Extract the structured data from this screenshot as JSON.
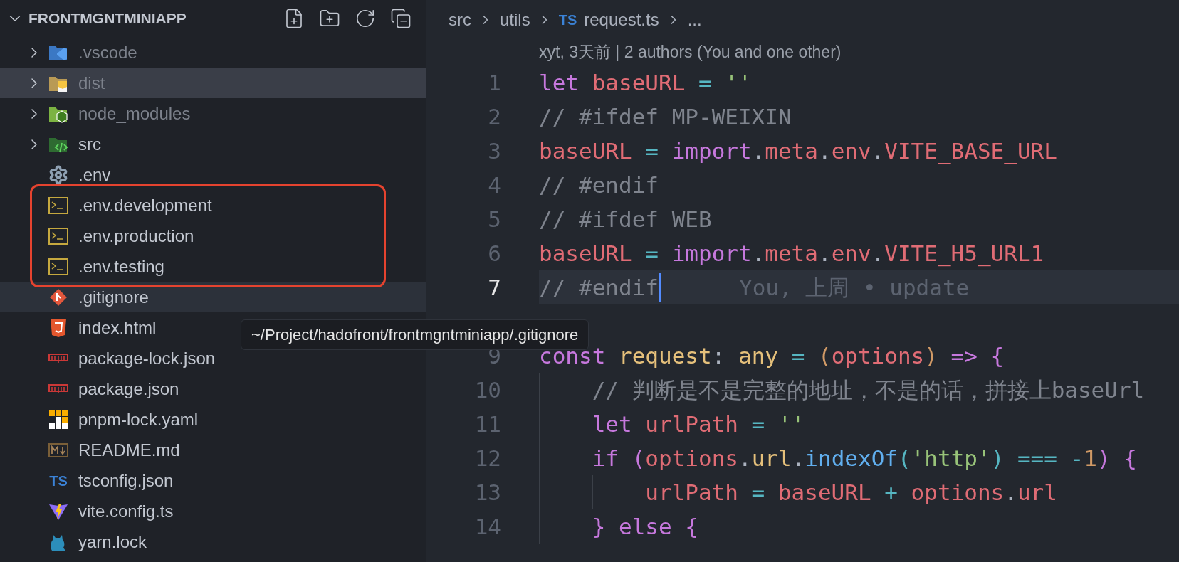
{
  "explorer": {
    "title": "FRONTMGNTMINIAPP",
    "expanded": true,
    "items": [
      {
        "name": ".vscode",
        "kind": "vscode",
        "expanded": false,
        "dimmed": true,
        "selected": false,
        "hovered": false
      },
      {
        "name": "dist",
        "kind": "dist",
        "expanded": false,
        "dimmed": true,
        "selected": true,
        "hovered": false
      },
      {
        "name": "node_modules",
        "kind": "node",
        "expanded": false,
        "dimmed": true,
        "selected": false,
        "hovered": false
      },
      {
        "name": "src",
        "kind": "src",
        "expanded": false,
        "dimmed": false,
        "selected": false,
        "hovered": false
      },
      {
        "name": ".env",
        "kind": "gear",
        "dimmed": false,
        "selected": false,
        "hovered": false
      },
      {
        "kind": "highlight",
        "items": [
          {
            "name": ".env.development",
            "kind": "terminal",
            "dimmed": false,
            "selected": false,
            "hovered": false
          },
          {
            "name": ".env.production",
            "kind": "terminal",
            "dimmed": false,
            "selected": false,
            "hovered": false
          },
          {
            "name": ".env.testing",
            "kind": "terminal",
            "dimmed": false,
            "selected": false,
            "hovered": false
          }
        ]
      },
      {
        "name": ".gitignore",
        "kind": "git",
        "dimmed": false,
        "selected": false,
        "hovered": true
      },
      {
        "name": "index.html",
        "kind": "html",
        "dimmed": false,
        "selected": false,
        "hovered": false
      },
      {
        "name": "package-lock.json",
        "kind": "npm",
        "dimmed": false,
        "selected": false,
        "hovered": false
      },
      {
        "name": "package.json",
        "kind": "npm",
        "dimmed": false,
        "selected": false,
        "hovered": false
      },
      {
        "name": "pnpm-lock.yaml",
        "kind": "pnpm",
        "dimmed": false,
        "selected": false,
        "hovered": false
      },
      {
        "name": "README.md",
        "kind": "markdown",
        "dimmed": false,
        "selected": false,
        "hovered": false
      },
      {
        "name": "tsconfig.json",
        "kind": "ts",
        "badge": "TS",
        "dimmed": false,
        "selected": false,
        "hovered": false
      },
      {
        "name": "vite.config.ts",
        "kind": "vite",
        "dimmed": false,
        "selected": false,
        "hovered": false
      },
      {
        "name": "yarn.lock",
        "kind": "yarn",
        "dimmed": false,
        "selected": false,
        "hovered": false
      }
    ]
  },
  "tooltip": "~/Project/hadofront/frontmgntminiapp/.gitignore",
  "breadcrumb": [
    {
      "label": "src"
    },
    {
      "label": "utils"
    },
    {
      "label": "request.ts",
      "badge": "TS"
    },
    {
      "label": "..."
    }
  ],
  "editor": {
    "blame_header": "xyt, 3天前 | 2 authors (You and one other)",
    "lines": [
      {
        "number": "1",
        "current": false,
        "tokens": [
          {
            "kind": "keyword",
            "text": "let "
          },
          {
            "kind": "variable",
            "text": "baseURL "
          },
          {
            "kind": "operator",
            "text": "= "
          },
          {
            "kind": "string",
            "text": "''"
          }
        ]
      },
      {
        "number": "2",
        "current": false,
        "tokens": [
          {
            "kind": "comment",
            "text": "// #ifdef MP-WEIXIN"
          }
        ]
      },
      {
        "number": "3",
        "current": false,
        "tokens": [
          {
            "kind": "variable",
            "text": "baseURL "
          },
          {
            "kind": "operator",
            "text": "= "
          },
          {
            "kind": "keyword",
            "text": "import"
          },
          {
            "kind": "punct",
            "text": "."
          },
          {
            "kind": "variable",
            "text": "meta"
          },
          {
            "kind": "punct",
            "text": "."
          },
          {
            "kind": "variable",
            "text": "env"
          },
          {
            "kind": "punct",
            "text": "."
          },
          {
            "kind": "variable",
            "text": "VITE_BASE_URL"
          }
        ]
      },
      {
        "number": "4",
        "current": false,
        "tokens": [
          {
            "kind": "comment",
            "text": "// #endif"
          }
        ]
      },
      {
        "number": "5",
        "current": false,
        "tokens": [
          {
            "kind": "comment",
            "text": "// #ifdef WEB"
          }
        ]
      },
      {
        "number": "6",
        "current": false,
        "tokens": [
          {
            "kind": "variable",
            "text": "baseURL "
          },
          {
            "kind": "operator",
            "text": "= "
          },
          {
            "kind": "keyword",
            "text": "import"
          },
          {
            "kind": "punct",
            "text": "."
          },
          {
            "kind": "variable",
            "text": "meta"
          },
          {
            "kind": "punct",
            "text": "."
          },
          {
            "kind": "variable",
            "text": "env"
          },
          {
            "kind": "punct",
            "text": "."
          },
          {
            "kind": "variable",
            "text": "VITE_H5_URL1"
          }
        ]
      },
      {
        "number": "7",
        "current": true,
        "blame": "You, 上周 • update",
        "tokens": [
          {
            "kind": "comment",
            "text": "// #endif"
          }
        ]
      },
      {
        "current": false
      },
      {
        "number": "9",
        "current": false,
        "tokens": [
          {
            "kind": "keyword",
            "text": "const "
          },
          {
            "kind": "type",
            "text": "request"
          },
          {
            "kind": "punct",
            "text": ": "
          },
          {
            "kind": "type",
            "text": "any "
          },
          {
            "kind": "operator",
            "text": "= "
          },
          {
            "kind": "number",
            "text": "("
          },
          {
            "kind": "variable",
            "text": "options"
          },
          {
            "kind": "number",
            "text": ") "
          },
          {
            "kind": "keyword",
            "text": "=> "
          },
          {
            "kind": "keyword",
            "text": "{"
          }
        ],
        "children": [
          {
            "number": "10",
            "current": false,
            "tokens": [
              {
                "kind": "comment",
                "text": "// 判断是不是完整的地址，不是的话，拼接上baseUrl"
              }
            ]
          },
          {
            "number": "11",
            "current": false,
            "tokens": [
              {
                "kind": "keyword",
                "text": "let "
              },
              {
                "kind": "variable",
                "text": "urlPath "
              },
              {
                "kind": "operator",
                "text": "= "
              },
              {
                "kind": "string",
                "text": "''"
              }
            ]
          },
          {
            "number": "12",
            "current": false,
            "tokens": [
              {
                "kind": "keyword",
                "text": "if "
              },
              {
                "kind": "keyword",
                "text": "("
              },
              {
                "kind": "variable",
                "text": "options"
              },
              {
                "kind": "punct",
                "text": "."
              },
              {
                "kind": "type",
                "text": "url"
              },
              {
                "kind": "punct",
                "text": "."
              },
              {
                "kind": "function",
                "text": "indexOf"
              },
              {
                "kind": "operator",
                "text": "("
              },
              {
                "kind": "string",
                "text": "'http'"
              },
              {
                "kind": "operator",
                "text": ") "
              },
              {
                "kind": "operator",
                "text": "=== -"
              },
              {
                "kind": "number",
                "text": "1"
              },
              {
                "kind": "keyword",
                "text": ") {"
              }
            ],
            "children": [
              {
                "number": "13",
                "current": false,
                "tokens": [
                  {
                    "kind": "variable",
                    "text": "urlPath "
                  },
                  {
                    "kind": "operator",
                    "text": "= "
                  },
                  {
                    "kind": "variable",
                    "text": "baseURL "
                  },
                  {
                    "kind": "operator",
                    "text": "+ "
                  },
                  {
                    "kind": "variable",
                    "text": "options"
                  },
                  {
                    "kind": "punct",
                    "text": "."
                  },
                  {
                    "kind": "variable",
                    "text": "url"
                  }
                ]
              }
            ]
          },
          {
            "number": "14",
            "current": false,
            "tokens": [
              {
                "kind": "keyword",
                "text": "} else {"
              }
            ]
          }
        ]
      }
    ]
  }
}
